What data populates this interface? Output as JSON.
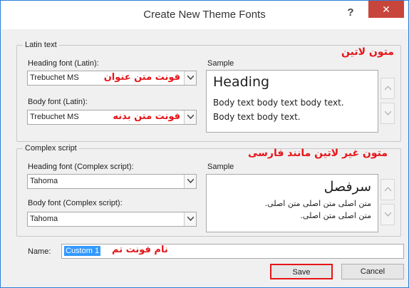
{
  "dialog": {
    "title": "Create New Theme Fonts",
    "help": "?",
    "close": "✕"
  },
  "latin": {
    "legend": "Latin text",
    "annotation_title": "متون لاتین",
    "heading_label": "Heading font (Latin):",
    "heading_value": "Trebuchet MS",
    "heading_annotation": "فونت متن عنوان",
    "body_label": "Body font (Latin):",
    "body_value": "Trebuchet MS",
    "body_annotation": "فونت متن بدنه",
    "sample_label": "Sample",
    "sample_heading": "Heading",
    "sample_body_1": "Body text body text body text.",
    "sample_body_2": "Body text body text."
  },
  "complex": {
    "legend": "Complex script",
    "annotation_title": "متون غیر لاتین مانند فارسی",
    "heading_label": "Heading font (Complex script):",
    "heading_value": "Tahoma",
    "body_label": "Body font (Complex script):",
    "body_value": "Tahoma",
    "sample_label": "Sample",
    "sample_heading": "سرفصل",
    "sample_body_1": "متن اصلی متن اصلی متن اصلی.",
    "sample_body_2": "متن اصلی متن اصلی."
  },
  "name": {
    "label": "Name:",
    "value": "Custom 1",
    "annotation": "نام فونت تم"
  },
  "buttons": {
    "save": "Save",
    "cancel": "Cancel"
  },
  "colors": {
    "annotation": "#e5151a",
    "close": "#c7453b",
    "selection": "#3399ff"
  }
}
